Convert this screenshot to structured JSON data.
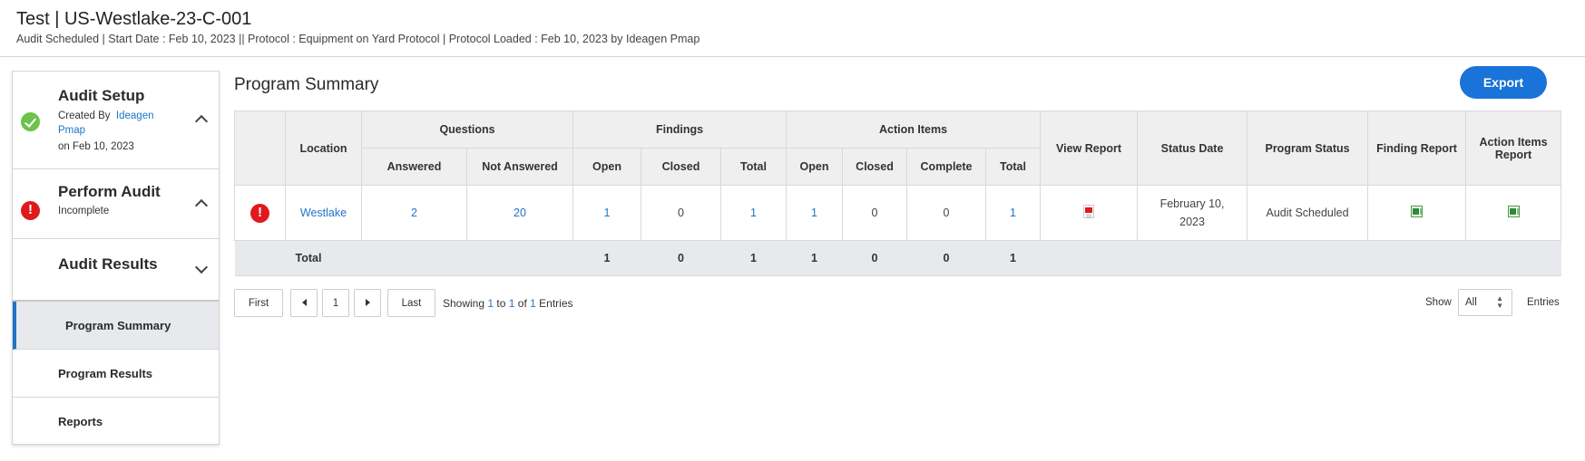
{
  "header": {
    "title": "Test | US-Westlake-23-C-001",
    "subtitle": "Audit Scheduled | Start Date : Feb 10, 2023 || Protocol : Equipment on Yard Protocol | Protocol Loaded : Feb 10, 2023 by Ideagen Pmap"
  },
  "sidebar": {
    "setup": {
      "title": "Audit Setup",
      "created_by_label": "Created By",
      "created_by_user": "Ideagen Pmap",
      "created_on": "on Feb 10, 2023"
    },
    "perform": {
      "title": "Perform Audit",
      "status": "Incomplete"
    },
    "results": {
      "title": "Audit Results"
    },
    "items": [
      "Program Summary",
      "Program Results",
      "Reports"
    ]
  },
  "main": {
    "title": "Program Summary",
    "export_label": "Export"
  },
  "table": {
    "groups": {
      "questions": "Questions",
      "findings": "Findings",
      "action_items": "Action Items"
    },
    "headers": {
      "location": "Location",
      "answered": "Answered",
      "not_answered": "Not Answered",
      "open": "Open",
      "closed": "Closed",
      "total": "Total",
      "complete": "Complete",
      "view_report": "View Report",
      "status_date": "Status Date",
      "program_status": "Program Status",
      "finding_report": "Finding Report",
      "action_items_report": "Action Items Report"
    },
    "rows": [
      {
        "location": "Westlake",
        "answered": "2",
        "not_answered": "20",
        "findings_open": "1",
        "findings_closed": "0",
        "findings_total": "1",
        "ai_open": "1",
        "ai_closed": "0",
        "ai_complete": "0",
        "ai_total": "1",
        "status_date": "February 10, 2023",
        "program_status": "Audit Scheduled"
      }
    ],
    "totals": {
      "label": "Total",
      "findings_open": "1",
      "findings_closed": "0",
      "findings_total": "1",
      "ai_open": "1",
      "ai_closed": "0",
      "ai_complete": "0",
      "ai_total": "1"
    }
  },
  "pagination": {
    "first": "First",
    "page": "1",
    "last": "Last",
    "showing_prefix": "Showing ",
    "from": "1",
    "to_label": " to ",
    "to": "1",
    "of_label": " of ",
    "of": "1",
    "suffix": " Entries",
    "show_label": "Show",
    "page_size": "All",
    "entries_label": "Entries"
  },
  "icons": {
    "setup_status": "check-circle-icon",
    "perform_status": "error-circle-icon",
    "view_report": "pdf-icon",
    "finding_report": "excel-icon",
    "action_items_report": "excel-icon"
  },
  "colors": {
    "accent": "#1a73d9",
    "success": "#6cc24a",
    "error": "#e0191e"
  }
}
